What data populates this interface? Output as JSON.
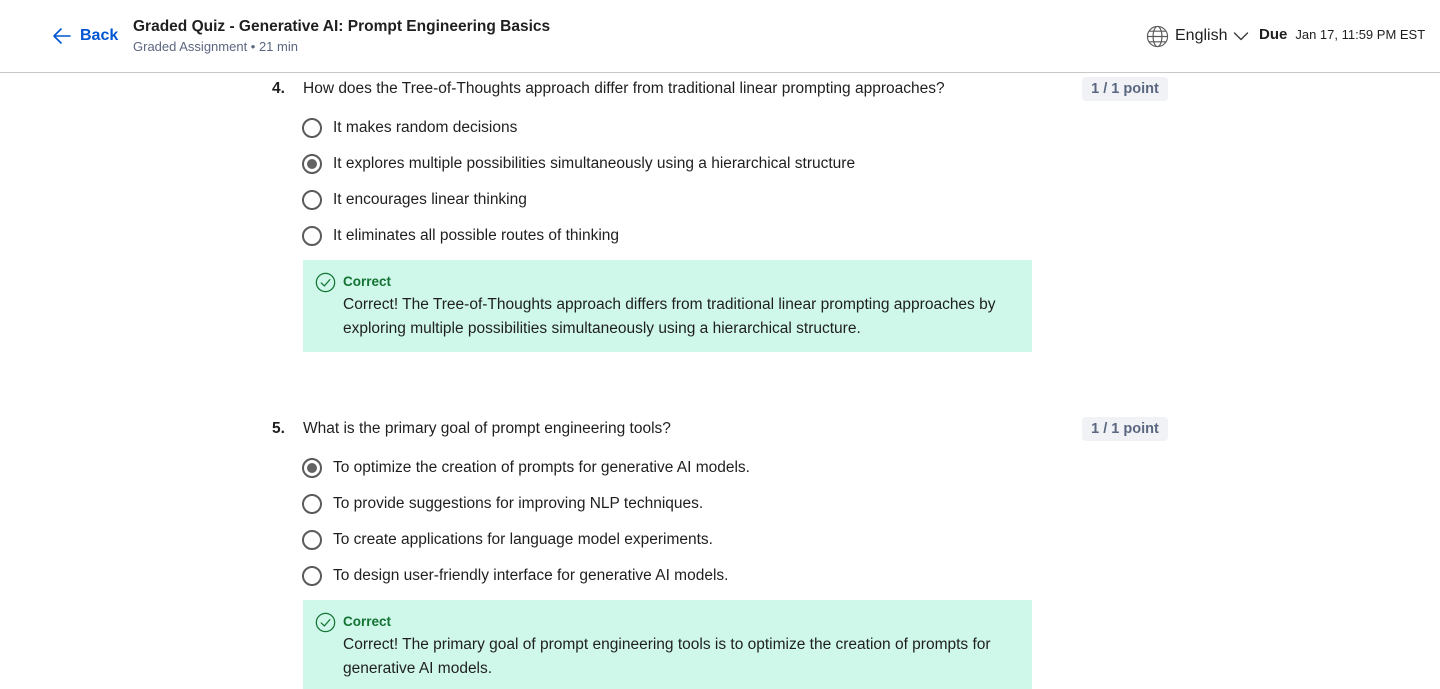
{
  "header": {
    "back_label": "Back",
    "title": "Graded Quiz - Generative AI: Prompt Engineering Basics",
    "subtitle": "Graded Assignment • 21 min",
    "language": "English",
    "due_label": "Due",
    "due_date": "Jan 17, 11:59 PM EST"
  },
  "questions": [
    {
      "number": "4.",
      "text": "How does the Tree-of-Thoughts approach differ from traditional linear prompting approaches?",
      "points": "1 / 1 point",
      "options": [
        {
          "label": "It makes random decisions",
          "selected": false
        },
        {
          "label": "It explores multiple possibilities simultaneously using a hierarchical structure",
          "selected": true
        },
        {
          "label": "It encourages linear thinking",
          "selected": false
        },
        {
          "label": "It eliminates all possible routes of thinking",
          "selected": false
        }
      ],
      "feedback": {
        "title": "Correct",
        "text": "Correct! The Tree-of-Thoughts approach differs from traditional linear prompting approaches by exploring multiple possibilities simultaneously using a hierarchical structure."
      }
    },
    {
      "number": "5.",
      "text": "What is the primary goal of prompt engineering tools?",
      "points": "1 / 1 point",
      "options": [
        {
          "label": "To optimize the creation of prompts for generative AI models.",
          "selected": true
        },
        {
          "label": "To provide suggestions for improving NLP techniques.",
          "selected": false
        },
        {
          "label": "To create applications for language model experiments.",
          "selected": false
        },
        {
          "label": "To design user-friendly interface for generative AI models.",
          "selected": false
        }
      ],
      "feedback": {
        "title": "Correct",
        "text": "Correct! The primary goal of prompt engineering tools is to optimize the creation of prompts for generative AI models."
      }
    }
  ],
  "colors": {
    "accent": "#0056d2",
    "correct_bg": "#cff8ea",
    "correct_text": "#137333"
  }
}
